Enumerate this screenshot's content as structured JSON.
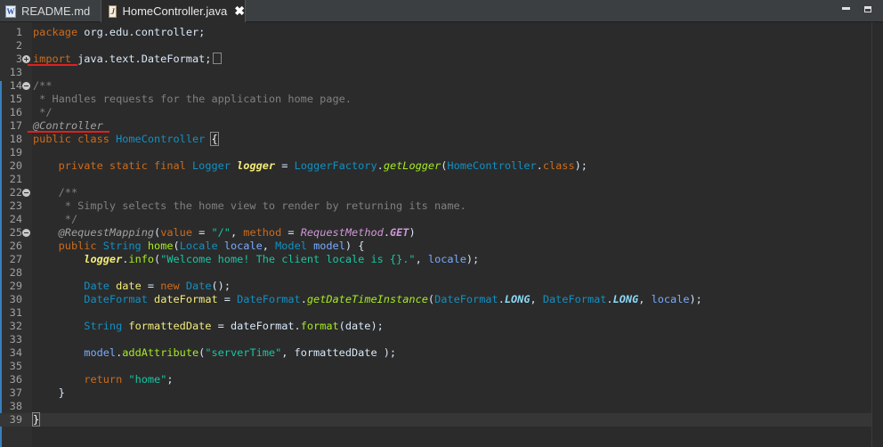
{
  "tabs": [
    {
      "label": "README.md",
      "icon": "word-document-icon",
      "active": false
    },
    {
      "label": "HomeController.java",
      "icon": "java-file-icon",
      "active": true,
      "close": "✖"
    }
  ],
  "lines": [
    {
      "n": "1",
      "fold": null,
      "html": "<span class='kw'>package</span> org.edu.controller;"
    },
    {
      "n": "2",
      "fold": null,
      "html": ""
    },
    {
      "n": "3",
      "fold": "plus",
      "html": "<span class='kw'>import</span> java.text.DateFormat;<span class='fold-marker'></span>"
    },
    {
      "n": "13",
      "fold": null,
      "html": ""
    },
    {
      "n": "14",
      "fold": "minus",
      "html": "<span class='cm'>/**</span>"
    },
    {
      "n": "15",
      "fold": null,
      "html": "<span class='cm'> * Handles requests for the application home page.</span>"
    },
    {
      "n": "16",
      "fold": null,
      "html": "<span class='cm'> */</span>"
    },
    {
      "n": "17",
      "fold": null,
      "html": "<span class='an'>@Controller</span>"
    },
    {
      "n": "18",
      "fold": null,
      "html": "<span class='kw'>public class</span> <span class='ty'>HomeController</span> <span class='brk'>{</span>"
    },
    {
      "n": "19",
      "fold": null,
      "html": ""
    },
    {
      "n": "20",
      "fold": null,
      "html": "    <span class='kw'>private static final</span> <span class='ty'>Logger</span> <span class='var bi'>logger</span> = <span class='ty'>LoggerFactory</span>.<span class='fn it'>getLogger</span>(<span class='ty'>HomeController</span>.<span class='kw'>class</span>);"
    },
    {
      "n": "21",
      "fold": null,
      "html": ""
    },
    {
      "n": "22",
      "fold": "minus",
      "html": "    <span class='cm'>/**</span>"
    },
    {
      "n": "23",
      "fold": null,
      "html": "<span class='cm'>     * Simply selects the home view to render by returning its name.</span>"
    },
    {
      "n": "24",
      "fold": null,
      "html": "<span class='cm'>     */</span>"
    },
    {
      "n": "25",
      "fold": "minus",
      "html": "    <span class='an'>@RequestMapping</span>(<span class='kw'>value</span> = <span class='st'>\"/\"</span>, <span class='kw'>method</span> = <span class='it' style='color:#d197d9'>RequestMethod</span>.<span class='bi' style='color:#d197d9'>GET</span>)"
    },
    {
      "n": "26",
      "fold": null,
      "html": "    <span class='kw'>public</span> <span class='ty'>String</span> <span class='fn'>home</span>(<span class='ty'>Locale</span> <span class='par'>locale</span>, <span class='ty'>Model</span> <span class='par'>model</span>) {"
    },
    {
      "n": "27",
      "fold": null,
      "html": "        <span class='var bi'>logger</span>.<span class='fn'>info</span>(<span class='st'>\"Welcome home! The client locale is {}.\"</span>, <span class='par'>locale</span>);"
    },
    {
      "n": "28",
      "fold": null,
      "html": ""
    },
    {
      "n": "29",
      "fold": null,
      "html": "        <span class='ty'>Date</span> <span class='var'>date</span> = <span class='kw'>new</span> <span class='ty'>Date</span>();"
    },
    {
      "n": "30",
      "fold": null,
      "html": "        <span class='ty'>DateFormat</span> <span class='var'>dateFormat</span> = <span class='ty'>DateFormat</span>.<span class='fn it'>getDateTimeInstance</span>(<span class='ty'>DateFormat</span>.<span class='bi' style='color:#8ddaf8'>LONG</span>, <span class='ty'>DateFormat</span>.<span class='bi' style='color:#8ddaf8'>LONG</span>, <span class='par'>locale</span>);"
    },
    {
      "n": "31",
      "fold": null,
      "html": ""
    },
    {
      "n": "32",
      "fold": null,
      "html": "        <span class='ty'>String</span> <span class='var'>formattedDate</span> = dateFormat.<span class='fn'>format</span>(date);"
    },
    {
      "n": "33",
      "fold": null,
      "html": ""
    },
    {
      "n": "34",
      "fold": null,
      "html": "        <span class='par'>model</span>.<span class='fn'>addAttribute</span>(<span class='st'>\"serverTime\"</span>, formattedDate );"
    },
    {
      "n": "35",
      "fold": null,
      "html": ""
    },
    {
      "n": "36",
      "fold": null,
      "html": "        <span class='kw'>return</span> <span class='st'>\"home\"</span>;"
    },
    {
      "n": "37",
      "fold": null,
      "html": "    }"
    },
    {
      "n": "38",
      "fold": null,
      "html": ""
    },
    {
      "n": "39",
      "fold": null,
      "html": "<span class='brk'>}</span>"
    }
  ]
}
